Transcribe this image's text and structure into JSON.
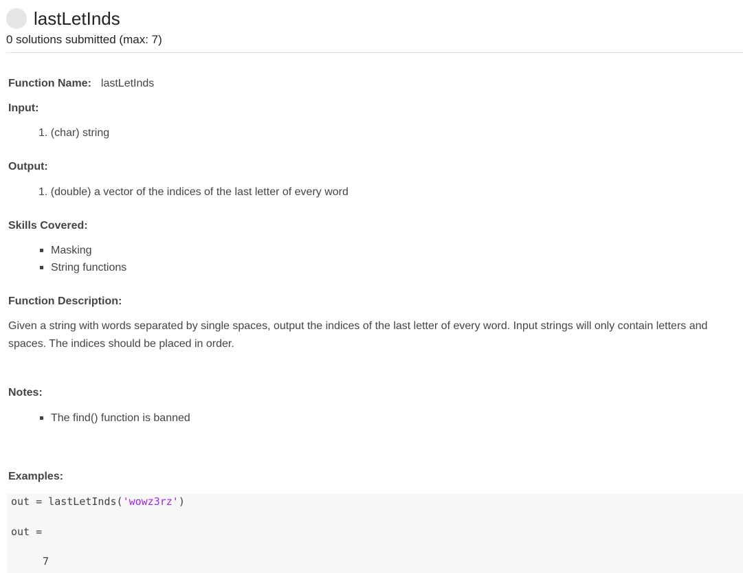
{
  "header": {
    "title": "lastLetInds",
    "submissions": "0 solutions submitted (max: 7)"
  },
  "problem": {
    "function_name_label": "Function Name:",
    "function_name": "lastLetInds",
    "input_label": "Input:",
    "inputs": [
      "(char) string"
    ],
    "output_label": "Output:",
    "outputs": [
      "(double) a vector of the indices of the last letter of every word"
    ],
    "skills_label": "Skills Covered:",
    "skills": [
      "Masking",
      "String functions"
    ],
    "description_label": "Function Description:",
    "description": "Given a string with words separated by single spaces, output the indices of the last letter of every word. Input strings will only contain letters and spaces. The indices should be placed in order.",
    "notes_label": "Notes:",
    "notes": [
      "The find() function is banned"
    ],
    "examples_label": "Examples:"
  },
  "example": {
    "call_prefix": "out = lastLetInds(",
    "call_arg": "'wowz3rz'",
    "call_suffix": ")",
    "out_label": "out =",
    "out_value": "7"
  },
  "colors": {
    "code_string": "#a020f0",
    "code_background": "#f7f7f7",
    "status_circle": "#e6e6e6"
  }
}
